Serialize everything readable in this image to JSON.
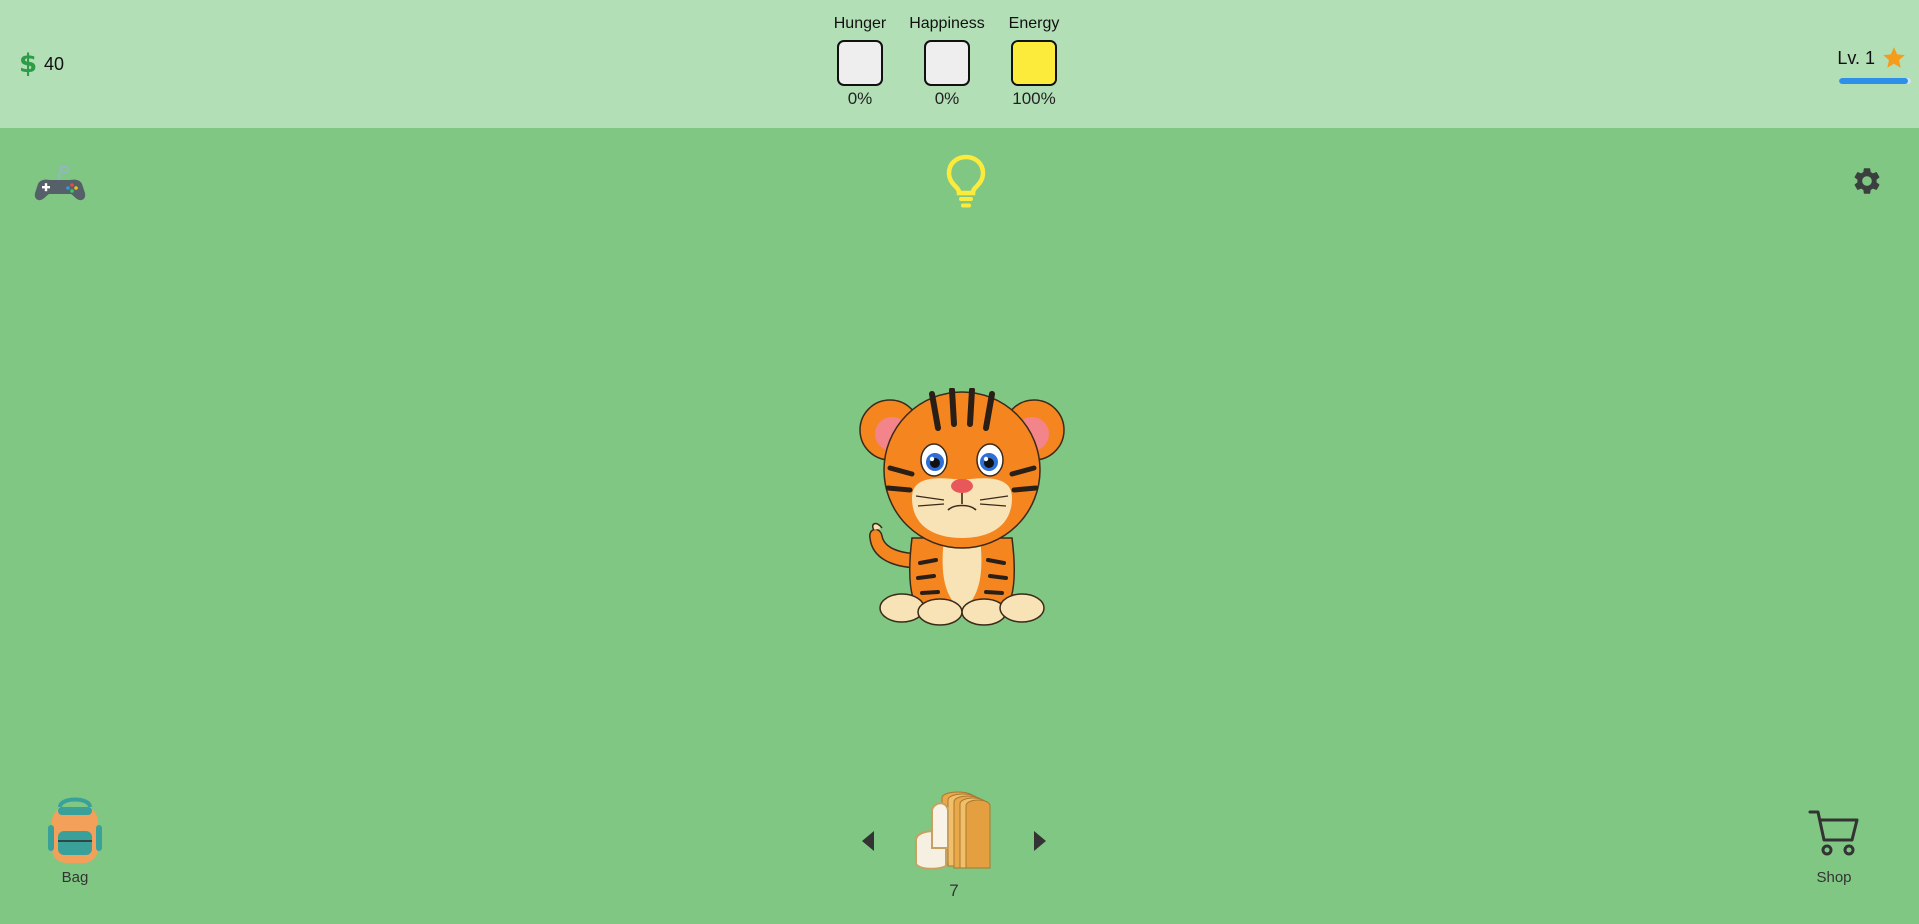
{
  "wallet": {
    "currency_icon": "dollar-icon",
    "amount": "40"
  },
  "stats": [
    {
      "label": "Hunger",
      "value_text": "0%",
      "value": 0,
      "fill_color": "#eeeeee"
    },
    {
      "label": "Happiness",
      "value_text": "0%",
      "value": 0,
      "fill_color": "#eeeeee"
    },
    {
      "label": "Energy",
      "value_text": "100%",
      "value": 1.0,
      "fill_color": "#fdeb3c"
    }
  ],
  "level": {
    "label": "Lv. 1",
    "star_icon": "star-icon",
    "xp_fraction": 0.96,
    "bar_color": "#2d8fe8"
  },
  "actions": {
    "minigames_icon": "gamepad-icon",
    "light_icon": "lightbulb-icon",
    "settings_icon": "gear-icon"
  },
  "pet": {
    "species_icon": "tiger-icon"
  },
  "bag": {
    "label": "Bag",
    "icon": "backpack-icon"
  },
  "food_selector": {
    "item_icon": "bread-icon",
    "count": "7"
  },
  "shop": {
    "label": "Shop",
    "icon": "cart-icon"
  },
  "colors": {
    "background": "#81c784",
    "topbar": "#b2dfb6",
    "bulb": "#fdeb3c",
    "star": "#f59c1a"
  }
}
